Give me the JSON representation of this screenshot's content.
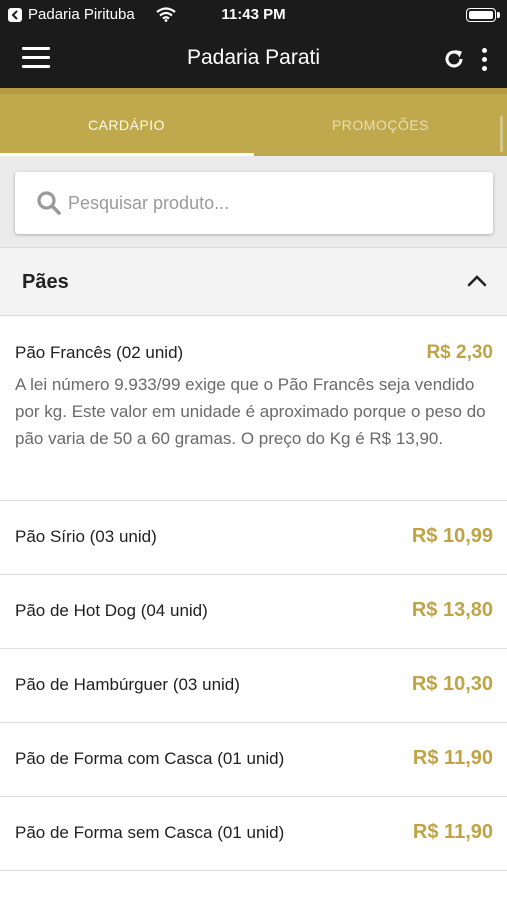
{
  "status_bar": {
    "carrier": "Padaria Pirituba",
    "time": "11:43 PM"
  },
  "toolbar": {
    "title": "Padaria Parati"
  },
  "tabs": [
    {
      "label": "CARDÁPIO",
      "active": true
    },
    {
      "label": "PROMOÇÕES",
      "active": false
    }
  ],
  "search": {
    "placeholder": "Pesquisar produto...",
    "value": ""
  },
  "category": {
    "title": "Pães",
    "expanded": true
  },
  "products": [
    {
      "name": "Pão Francês (02 unid)",
      "price": "R$ 2,30",
      "description": "A lei número 9.933/99 exige que o Pão Francês seja vendido por kg. Este valor em unidade é aproximado porque o peso do pão varia de 50 a 60 gramas. O preço do Kg é R$ 13,90."
    },
    {
      "name": "Pão Sírio (03 unid)",
      "price": "R$ 10,99"
    },
    {
      "name": "Pão de Hot Dog (04 unid)",
      "price": "R$ 13,80"
    },
    {
      "name": "Pão de Hambúrguer (03 unid)",
      "price": "R$ 10,30"
    },
    {
      "name": "Pão de Forma com Casca (01 unid)",
      "price": "R$ 11,90"
    },
    {
      "name": "Pão de Forma sem Casca (01 unid)",
      "price": "R$ 11,90"
    }
  ],
  "colors": {
    "toolbar": "#1b1b1b",
    "accent_gold": "#c0a84d",
    "price_gold": "#bfa446"
  },
  "icons": {
    "menu": "hamburger-icon",
    "refresh": "refresh-icon",
    "more": "more-vertical-icon",
    "search": "search-icon",
    "collapse": "chevron-up-icon"
  }
}
